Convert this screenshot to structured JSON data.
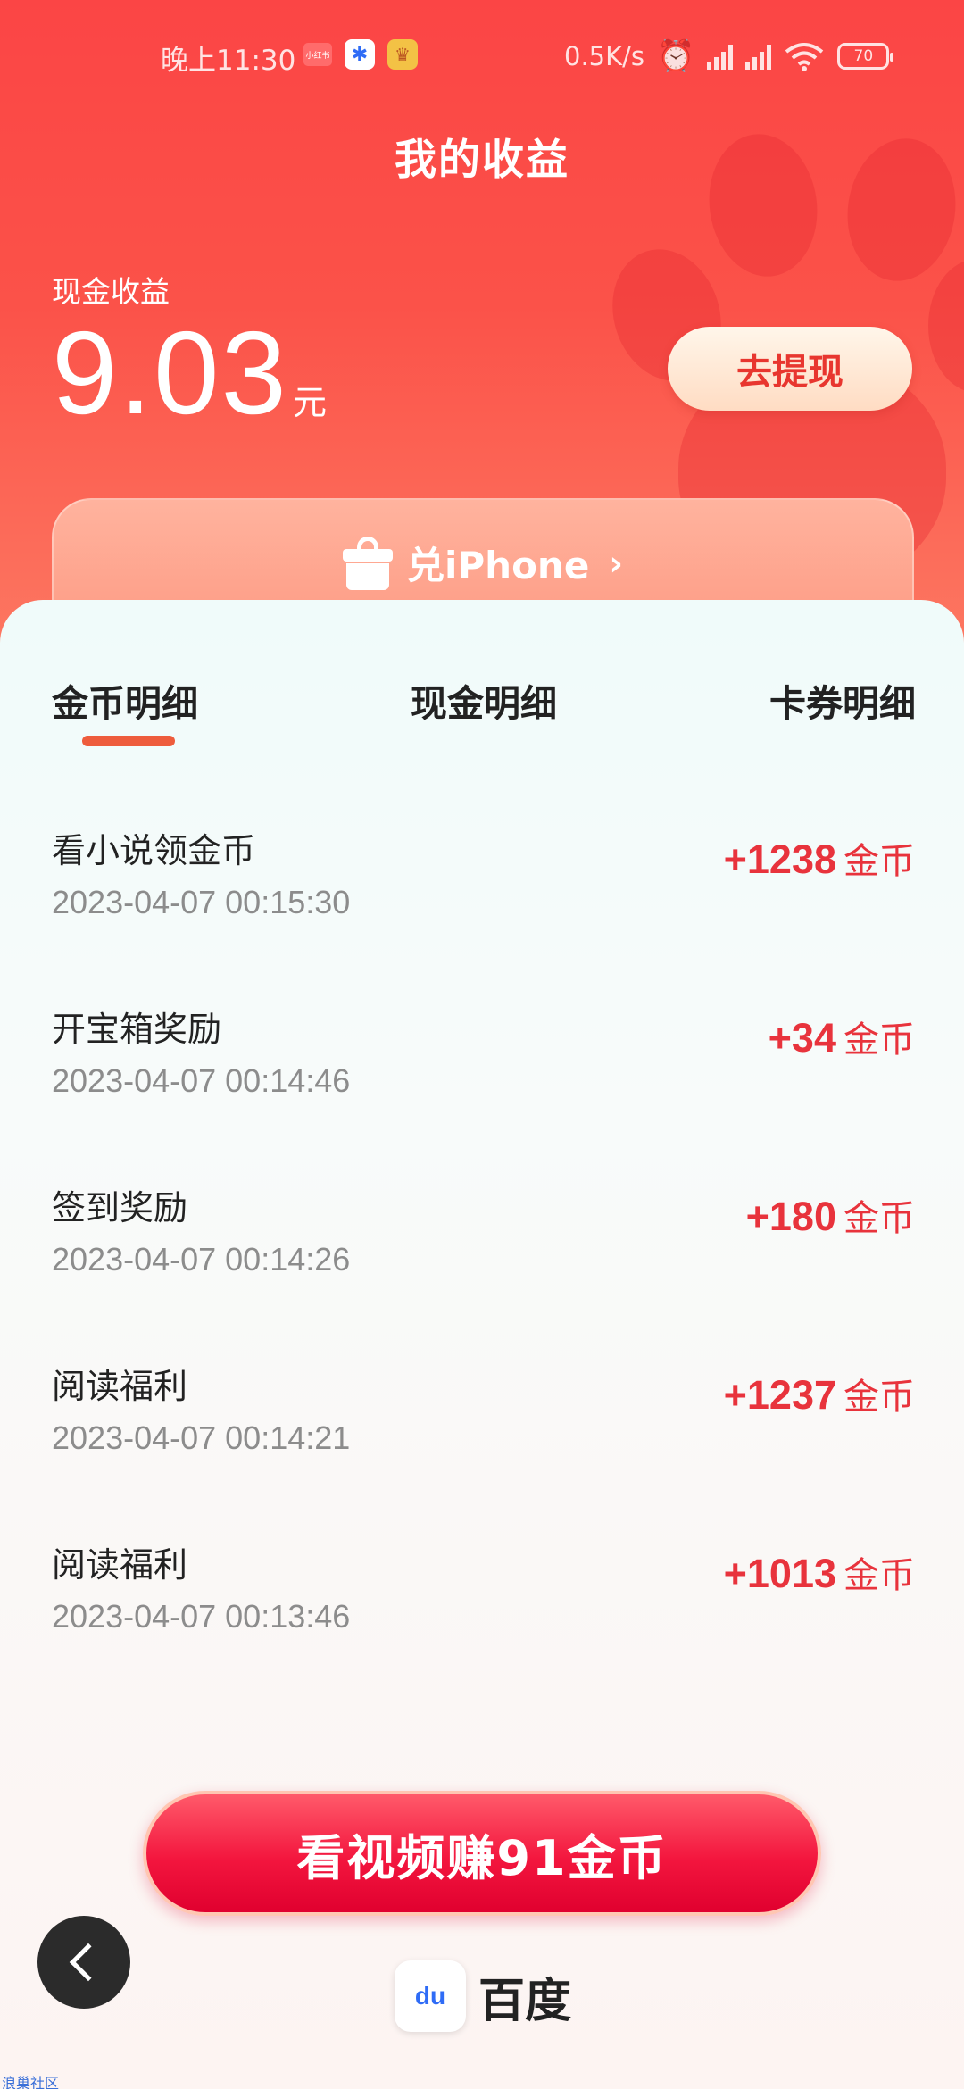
{
  "status_bar": {
    "time": "晚上11:30",
    "app_icons": [
      "xiaohongshu-icon",
      "baidu-icon",
      "game-icon"
    ],
    "xhs_label": "小红书",
    "network_speed": "0.5K/s",
    "battery": "70"
  },
  "header": {
    "title": "我的收益",
    "cash_label": "现金收益",
    "cash_amount": "9.03",
    "cash_unit": "元",
    "withdraw_label": "去提现",
    "banner_label": "兑iPhone",
    "banner_chevron": "›"
  },
  "tabs": [
    {
      "label": "金币明细",
      "active": true
    },
    {
      "label": "现金明细",
      "active": false
    },
    {
      "label": "卡券明细",
      "active": false
    }
  ],
  "records": [
    {
      "title": "看小说领金币",
      "time": "2023-04-07 00:15:30",
      "amount": "+1238",
      "unit": "金币"
    },
    {
      "title": "开宝箱奖励",
      "time": "2023-04-07 00:14:46",
      "amount": "+34",
      "unit": "金币"
    },
    {
      "title": "签到奖励",
      "time": "2023-04-07 00:14:26",
      "amount": "+180",
      "unit": "金币"
    },
    {
      "title": "阅读福利",
      "time": "2023-04-07 00:14:21",
      "amount": "+1237",
      "unit": "金币"
    },
    {
      "title": "阅读福利",
      "time": "2023-04-07 00:13:46",
      "amount": "+1013",
      "unit": "金币"
    }
  ],
  "bottom": {
    "cta_label": "看视频赚91金币",
    "brand_name": "百度",
    "brand_icon_text": "du",
    "watermark": "浪巢社区"
  },
  "colors": {
    "header_red": "#fb4545",
    "amount_red": "#e8333c",
    "tab_underline": "#ee5c3c",
    "cta_red": "#f3163e"
  }
}
